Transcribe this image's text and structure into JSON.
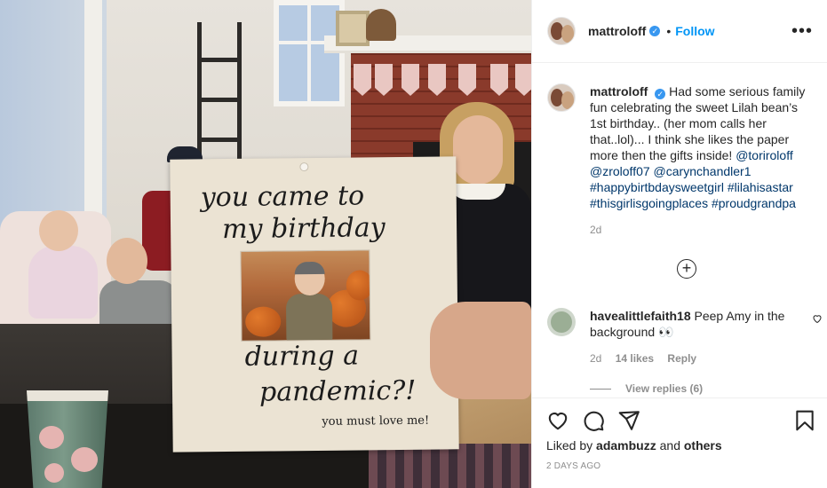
{
  "post": {
    "author": "mattroloff",
    "follow_label": "Follow",
    "dot": "•",
    "more_label": "•••",
    "photo_sign": {
      "line1": "you came to",
      "line2": "my birthday",
      "line3": "during a",
      "line4": "pandemic?!",
      "line5": "you must love me!"
    }
  },
  "caption": {
    "author": "mattroloff",
    "text": "Had some serious family fun celebrating the sweet Lilah bean’s 1st birthday.. (her mom calls her that..lol)... I think she likes the paper more then the gifts inside!",
    "mentions": [
      "@toriroloff",
      "@zroloff07",
      "@carynchandler1",
      "#happybirtbdaysweetgirl",
      "#lilahisastar",
      "#thisgirlisgoingplaces",
      "#proudgrandpa"
    ],
    "time": "2d"
  },
  "load_more_label": "+",
  "comment": {
    "author": "havealittlefaith18",
    "text": "Peep Amy in the background 👀",
    "time": "2d",
    "likes": "14 likes",
    "reply_label": "Reply",
    "view_replies": "View replies (6)"
  },
  "footer": {
    "liked_prefix": "Liked by",
    "liked_user": "adambuzz",
    "liked_and": "and",
    "liked_others": "others",
    "timestamp": "2 DAYS AGO"
  },
  "icons": {
    "verified": "verified-badge",
    "like": "heart-icon",
    "comment": "comment-icon",
    "share": "share-icon",
    "save": "bookmark-icon",
    "options": "more-icon",
    "load_more": "plus-circle-icon",
    "comment_like": "small-heart-icon"
  },
  "colors": {
    "link_blue": "#0095f6",
    "mention_blue": "#00376b",
    "verified_blue": "#3897f0",
    "muted_gray": "#8e8e8e"
  }
}
